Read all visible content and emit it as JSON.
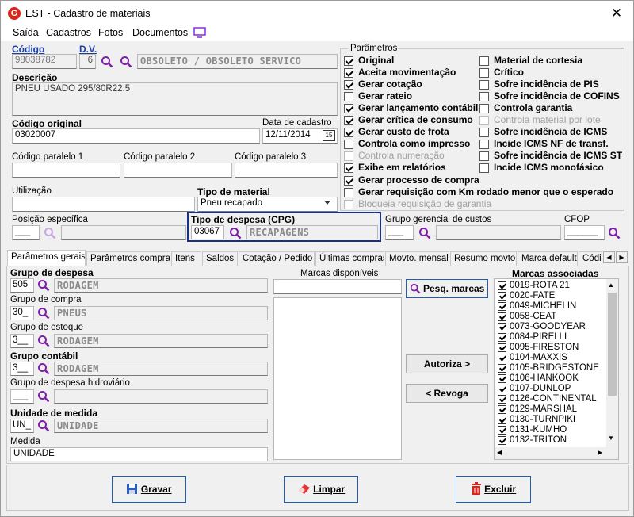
{
  "window": {
    "title": "EST - Cadastro de materiais",
    "app_icon": "G"
  },
  "menu": [
    "Saída",
    "Cadastros",
    "Fotos",
    "Documentos"
  ],
  "labels": {
    "codigo": "Código",
    "dv": "D.V.",
    "descricao": "Descrição",
    "codigo_original": "Código original",
    "data_cadastro": "Data de cadastro",
    "cod_par1": "Código paralelo 1",
    "cod_par2": "Código paralelo 2",
    "cod_par3": "Código paralelo 3",
    "utilizacao": "Utilização",
    "tipo_material": "Tipo de material",
    "posicao": "Posição específica",
    "tipo_despesa": "Tipo de despesa (CPG)",
    "grupo_gerencial": "Grupo gerencial de custos",
    "cfop": "CFOP",
    "parametros": "Parâmetros"
  },
  "values": {
    "codigo": "98038782",
    "dv": "6",
    "status": "OBSOLETO / OBSOLETO SERVICO",
    "descricao": "PNEU USADO 295/80R22.5",
    "codigo_original": "03020007",
    "data_cadastro": "12/11/2014",
    "calendar": "15",
    "tipo_material": "Pneu recapado",
    "tipo_despesa_code": "03067",
    "tipo_despesa_desc": "RECAPAGENS"
  },
  "params_left": [
    {
      "label": "Original",
      "checked": true,
      "disabled": false
    },
    {
      "label": "Aceita movimentação",
      "checked": true,
      "disabled": false
    },
    {
      "label": "Gerar cotação",
      "checked": true,
      "disabled": false
    },
    {
      "label": "Gerar rateio",
      "checked": false,
      "disabled": false
    },
    {
      "label": "Gerar lançamento contábil",
      "checked": true,
      "disabled": false
    },
    {
      "label": "Gerar crítica de consumo",
      "checked": true,
      "disabled": false
    },
    {
      "label": "Gerar custo de frota",
      "checked": true,
      "disabled": false
    },
    {
      "label": "Controla como impresso",
      "checked": false,
      "disabled": false
    },
    {
      "label": "Controla numeração",
      "checked": false,
      "disabled": true
    },
    {
      "label": "Exibe em relatórios",
      "checked": true,
      "disabled": false
    }
  ],
  "params_right": [
    {
      "label": "Material de cortesia",
      "checked": false,
      "disabled": false
    },
    {
      "label": "Crítico",
      "checked": false,
      "disabled": false
    },
    {
      "label": "Sofre incidência de PIS",
      "checked": false,
      "disabled": false
    },
    {
      "label": "Sofre incidência de COFINS",
      "checked": false,
      "disabled": false
    },
    {
      "label": "Controla garantia",
      "checked": false,
      "disabled": false
    },
    {
      "label": "Controla material por lote",
      "checked": false,
      "disabled": true
    },
    {
      "label": "Sofre incidência de ICMS",
      "checked": false,
      "disabled": false
    },
    {
      "label": "Incide ICMS NF de transf.",
      "checked": false,
      "disabled": false
    },
    {
      "label": "Sofre incidência de ICMS ST",
      "checked": false,
      "disabled": false
    },
    {
      "label": "Incide ICMS monofásico",
      "checked": false,
      "disabled": false
    }
  ],
  "params_wide": [
    {
      "label": "Gerar processo de compra",
      "checked": true,
      "disabled": false
    },
    {
      "label": "Gerar requisição com Km rodado menor que o esperado",
      "checked": false,
      "disabled": false
    },
    {
      "label": "Bloqueia requisição de garantia",
      "checked": false,
      "disabled": true
    }
  ],
  "tabs": [
    "Parâmetros gerais",
    "Parâmetros compras",
    "Itens",
    "Saldos",
    "Cotação / Pedido",
    "Últimas compras",
    "Movto. mensal",
    "Resumo movto.",
    "Marca default",
    "Códi"
  ],
  "grupos": [
    {
      "label": "Grupo de despesa",
      "bold": true,
      "code": "505",
      "desc": "RODAGEM"
    },
    {
      "label": "Grupo de compra",
      "bold": false,
      "code": "30_",
      "desc": "PNEUS"
    },
    {
      "label": "Grupo de estoque",
      "bold": false,
      "code": "3__",
      "desc": "RODAGEM"
    },
    {
      "label": "Grupo contábil",
      "bold": true,
      "code": "3__",
      "desc": "RODAGEM"
    },
    {
      "label": "Grupo de despesa hidroviário",
      "bold": false,
      "code": "___",
      "desc": ""
    },
    {
      "label": "Unidade de medida",
      "bold": true,
      "code": "UN_",
      "desc": "UNIDADE"
    }
  ],
  "medida": {
    "label": "Medida",
    "value": "UNIDADE"
  },
  "marcas": {
    "disponiveis": "Marcas disponíveis",
    "associadas": "Marcas associadas",
    "pesq": "Pesq. marcas",
    "autoriza": "Autoriza >",
    "revoga": "< Revoga",
    "items": [
      "0019-ROTA 21",
      "0020-FATE",
      "0049-MICHELIN",
      "0058-CEAT",
      "0073-GOODYEAR",
      "0084-PIRELLI",
      "0095-FIRESTON",
      "0104-MAXXIS",
      "0105-BRIDGESTONE",
      "0106-HANKOOK",
      "0107-DUNLOP",
      "0126-CONTINENTAL",
      "0129-MARSHAL",
      "0130-TURNPIKI",
      "0131-KUMHO",
      "0132-TRITON"
    ]
  },
  "buttons": {
    "gravar": "Gravar",
    "limpar": "Limpar",
    "excluir": "Excluir"
  },
  "colors": {
    "accent": "#1a5fb4",
    "magnifier": "#7d1fa6"
  }
}
